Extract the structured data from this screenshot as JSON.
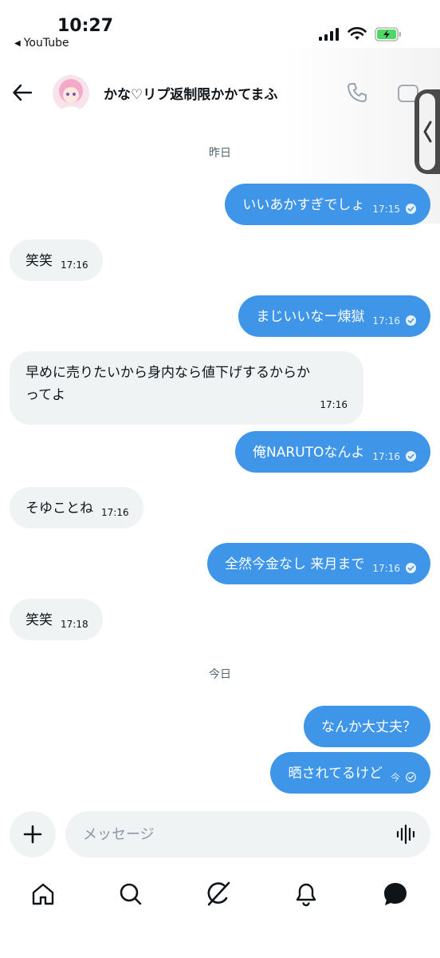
{
  "status_bar": {
    "time": "10:27",
    "back_app": "YouTube",
    "icons": [
      "cellular-signal-icon",
      "wifi-icon",
      "battery-charging-icon"
    ]
  },
  "header": {
    "contact_name": "かな♡リプ返制限かかてまふ",
    "icons": [
      "back-arrow-icon",
      "phone-icon",
      "video-call-icon"
    ]
  },
  "days": {
    "yesterday": "昨日",
    "today": "今日"
  },
  "messages": [
    {
      "from": "me",
      "text": "いいあかすぎでしょ",
      "time": "17:15",
      "status": "read"
    },
    {
      "from": "them",
      "text": "笑笑",
      "time": "17:16"
    },
    {
      "from": "me",
      "text": "まじいいなー煉獄",
      "time": "17:16",
      "status": "read"
    },
    {
      "from": "them",
      "text_line1": "早めに売りたいから身内なら値下げするからか",
      "text_line2": "ってよ",
      "time": "17:16"
    },
    {
      "from": "me",
      "text": "俺NARUTOなんよ",
      "time": "17:16",
      "status": "read"
    },
    {
      "from": "them",
      "text": "そゆことね",
      "time": "17:16"
    },
    {
      "from": "me",
      "text": "全然今金なし 来月まで",
      "time": "17:16",
      "status": "read"
    },
    {
      "from": "them",
      "text": "笑笑",
      "time": "17:18"
    },
    {
      "from": "me",
      "text": "なんか大丈夫？"
    },
    {
      "from": "me",
      "text": "晒されてるけど",
      "time": "今",
      "status": "sent"
    }
  ],
  "composer": {
    "placeholder": "メッセージ",
    "value": ""
  },
  "bottom_nav": [
    "home-icon",
    "search-icon",
    "grok-icon",
    "notifications-icon",
    "messages-icon"
  ],
  "colors": {
    "my_bubble": "#3f95e8",
    "their_bubble": "#eff3f4",
    "battery": "#4cd964"
  }
}
